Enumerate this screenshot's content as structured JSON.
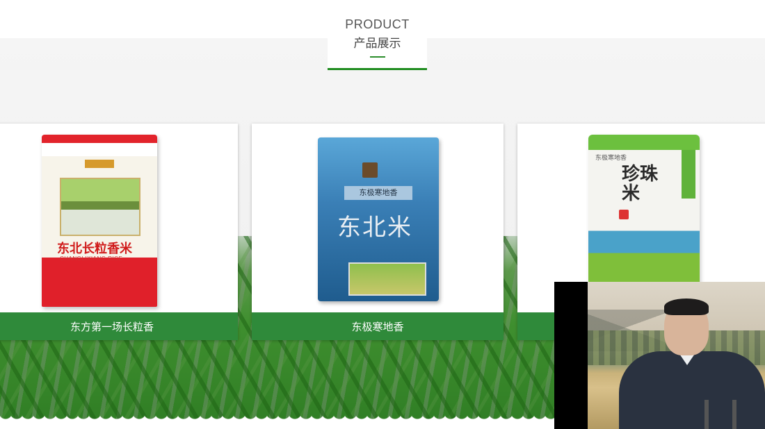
{
  "header": {
    "title_en": "PRODUCT",
    "title_zh": "产品展示"
  },
  "products": [
    {
      "caption": "东方第一场长粒香",
      "bag_name": "东北长粒香米",
      "bag_sub": "CHANGLIXIANG RICE"
    },
    {
      "caption": "东极寒地香",
      "bag_label": "东极寒地香",
      "bag_big": "东北米"
    },
    {
      "caption": "",
      "bag_big": "珍珠米",
      "bag_small": "东极寒地香"
    }
  ],
  "colors": {
    "accent_green": "#1e8c1e",
    "caption_bg": "#2f8a3a"
  }
}
